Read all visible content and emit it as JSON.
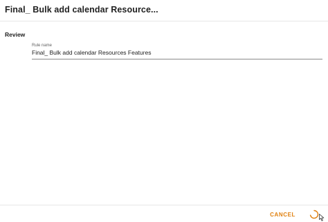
{
  "header": {
    "title": "Final_ Bulk add calendar Resource..."
  },
  "review": {
    "section_label": "Review",
    "rule_name_label": "Rule name",
    "rule_name_value": "Final_ Bulk add calendar Resources Features"
  },
  "footer": {
    "cancel_label": "CANCEL",
    "spinner_icon": "loading-spinner",
    "accent_color": "#e0800f"
  }
}
